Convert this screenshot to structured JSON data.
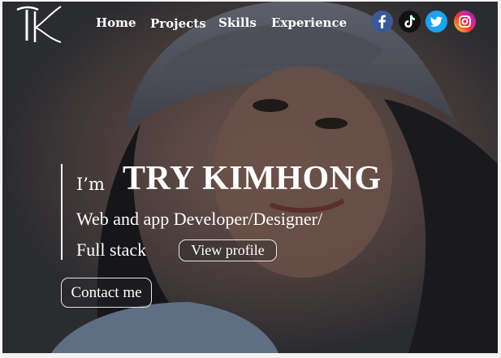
{
  "nav": {
    "items": [
      {
        "label": "Home"
      },
      {
        "label": "Projects"
      },
      {
        "label": "Skills"
      },
      {
        "label": "Experience"
      }
    ]
  },
  "social": [
    {
      "icon": "facebook-icon",
      "color": "#3b5998",
      "glyph": "f"
    },
    {
      "icon": "tiktok-icon",
      "color": "#111111",
      "glyph": "♪"
    },
    {
      "icon": "twitter-icon",
      "color": "#1da1f2",
      "glyph": "t"
    },
    {
      "icon": "instagram-icon",
      "color": "#d6249f",
      "glyph": "◎"
    }
  ],
  "hero": {
    "prefix": "I’m",
    "name": "TRY KIMHONG",
    "role_line1": "Web and app Developer/Designer/",
    "role_line2": "Full stack",
    "view_profile": "View profile",
    "contact": "Contact me"
  }
}
